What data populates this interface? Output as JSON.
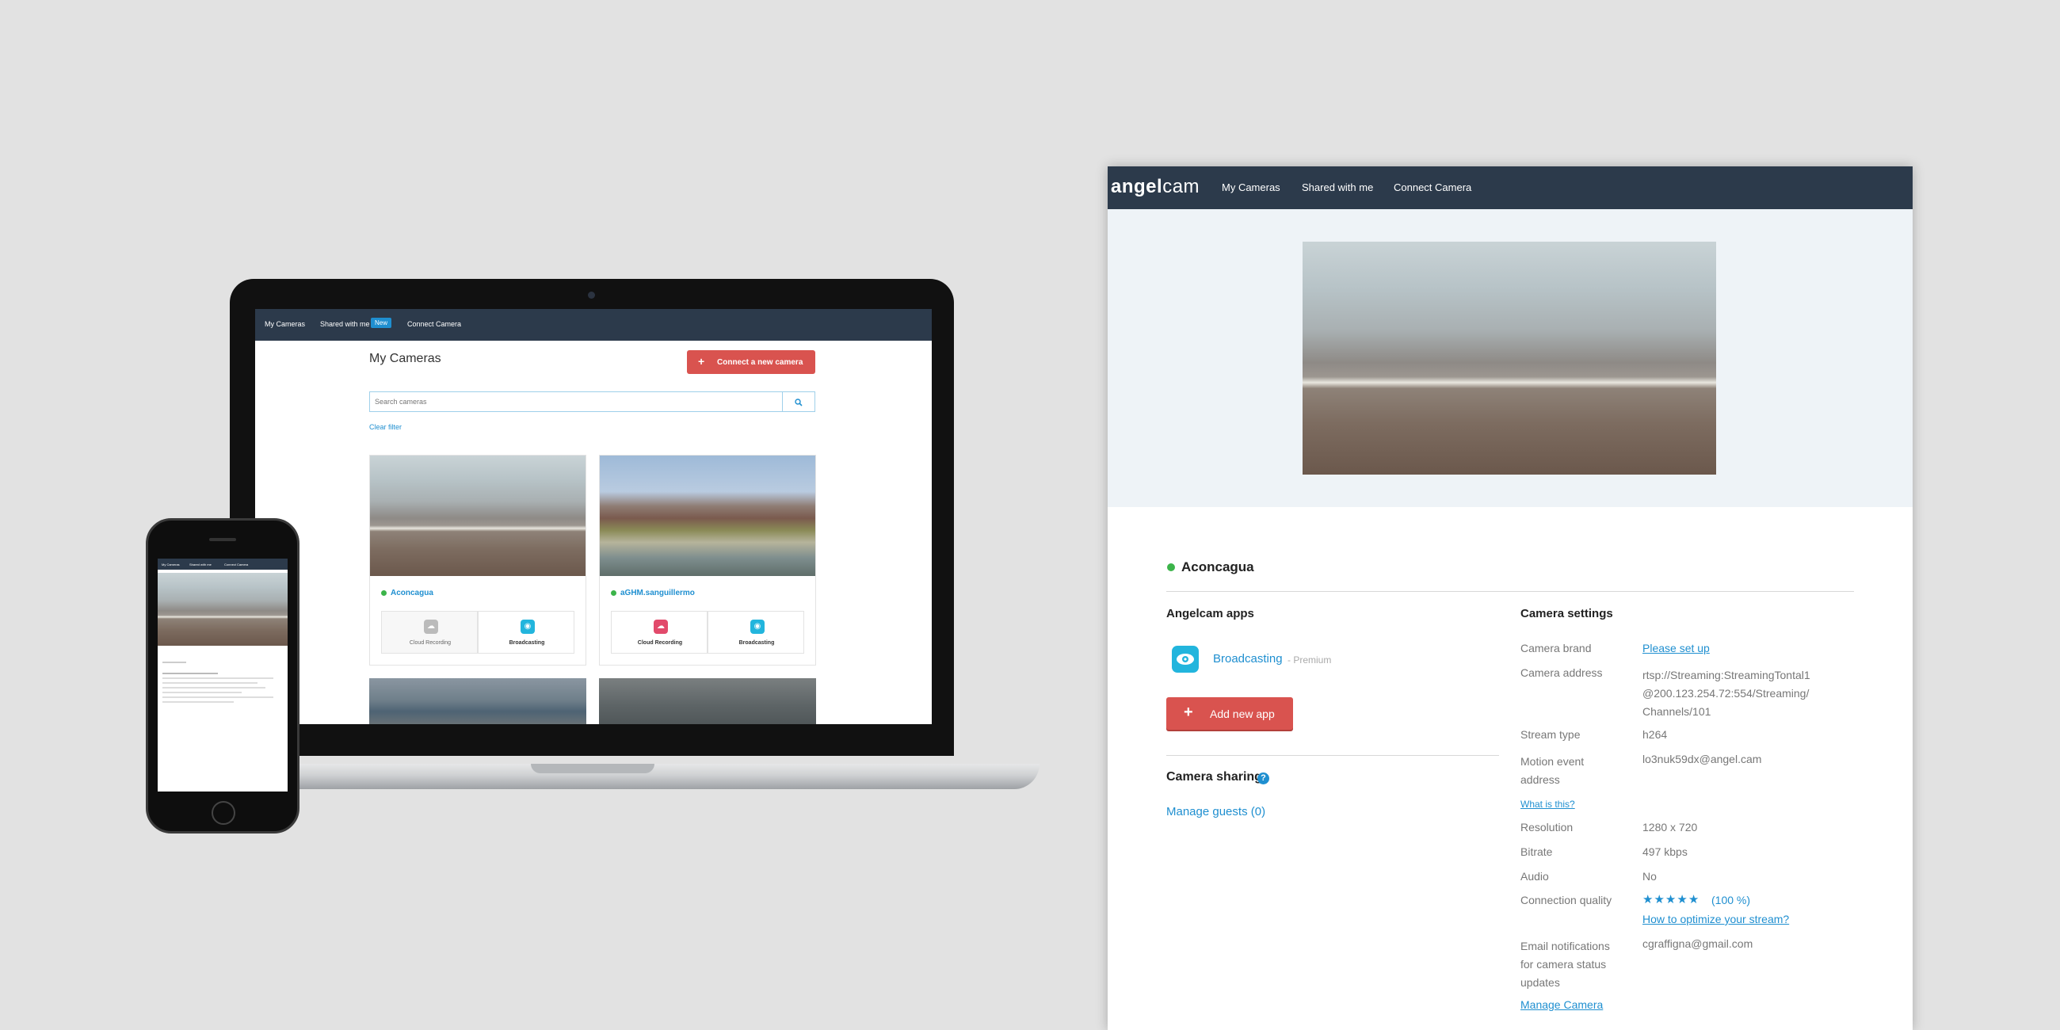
{
  "laptop": {
    "nav": {
      "my_cameras": "My Cameras",
      "shared": "Shared with me",
      "shared_badge": "New",
      "connect": "Connect Camera"
    },
    "page_title": "My Cameras",
    "connect_button": "Connect a new camera",
    "search_placeholder": "Search cameras",
    "clear_filter": "Clear filter",
    "cards": [
      {
        "name": "Aconcagua",
        "app1": "Cloud Recording",
        "app2": "Broadcasting"
      },
      {
        "name": "aGHM.sanguillermo",
        "app1": "Cloud Recording",
        "app2": "Broadcasting"
      }
    ]
  },
  "phone": {
    "nav": [
      "My Cameras",
      "Shared with me",
      "Connect Camera"
    ]
  },
  "detail": {
    "brand": {
      "a": "angel",
      "b": "cam"
    },
    "nav": {
      "my_cameras": "My Cameras",
      "shared": "Shared with me",
      "connect": "Connect Camera"
    },
    "camera_name": "Aconcagua",
    "apps_heading": "Angelcam apps",
    "app_name": "Broadcasting",
    "app_tier": "- Premium",
    "add_app_button": "Add new app",
    "sharing_heading": "Camera sharing",
    "sharing_help": "?",
    "manage_guests": "Manage guests (0)",
    "settings_heading": "Camera settings",
    "settings": {
      "brand_label": "Camera brand",
      "brand_value": "Please set up",
      "address_label": "Camera address",
      "address_value": "rtsp://Streaming:StreamingTontal1@200.123.254.72:554/Streaming/Channels/101",
      "stream_label": "Stream type",
      "stream_value": "h264",
      "motion_label": "Motion event address",
      "motion_value": "lo3nuk59dx@angel.cam",
      "what_is_this": "What is this?",
      "resolution_label": "Resolution",
      "resolution_value": "1280 x 720",
      "bitrate_label": "Bitrate",
      "bitrate_value": "497 kbps",
      "audio_label": "Audio",
      "audio_value": "No",
      "quality_label": "Connection quality",
      "quality_stars": 5,
      "quality_value": "(100 %)",
      "optimize_link": "How to optimize your stream?",
      "email_label": "Email notifications for camera status updates",
      "email_value": "cgraffigna@gmail.com",
      "manage_camera": "Manage Camera"
    }
  },
  "colors": {
    "nav_bg": "#2c3a4b",
    "accent_red": "#d9534f",
    "link_blue": "#1f8fd0",
    "online_green": "#3cb44a",
    "broadcast_cyan": "#22b5dd"
  }
}
